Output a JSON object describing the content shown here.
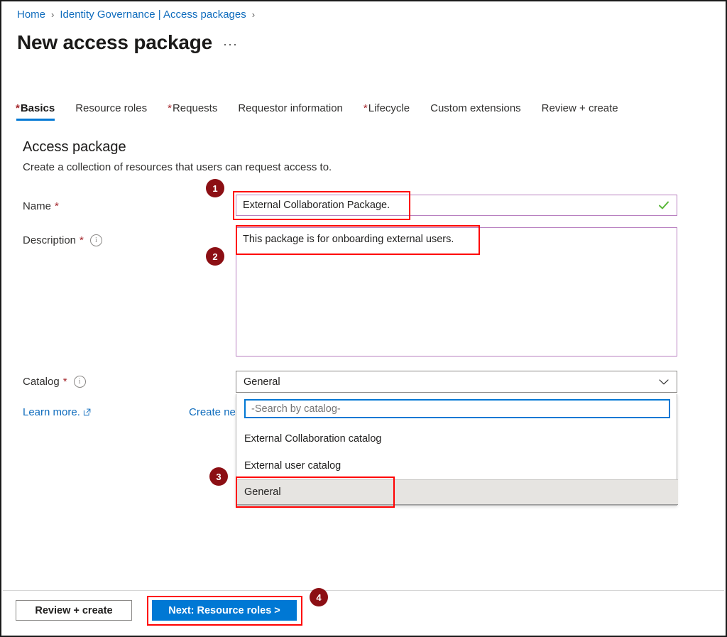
{
  "breadcrumb": {
    "items": [
      {
        "label": "Home"
      },
      {
        "label": "Identity Governance | Access packages"
      }
    ],
    "separator": "›"
  },
  "header": {
    "title": "New access package",
    "ellipsis": "···"
  },
  "tabs": [
    {
      "label": "Basics",
      "required": true,
      "active": true
    },
    {
      "label": "Resource roles",
      "required": false,
      "active": false
    },
    {
      "label": "Requests",
      "required": true,
      "active": false
    },
    {
      "label": "Requestor information",
      "required": false,
      "active": false
    },
    {
      "label": "Lifecycle",
      "required": true,
      "active": false
    },
    {
      "label": "Custom extensions",
      "required": false,
      "active": false
    },
    {
      "label": "Review + create",
      "required": false,
      "active": false
    }
  ],
  "section": {
    "title": "Access package",
    "subtitle": "Create a collection of resources that users can request access to."
  },
  "form": {
    "name": {
      "label": "Name",
      "required_marker": "*",
      "value": "External Collaboration Package.",
      "validation_icon": "checkmark-icon"
    },
    "description": {
      "label": "Description",
      "required_marker": "*",
      "info_icon": "info-icon",
      "value": "This package is for onboarding external users."
    },
    "catalog": {
      "label": "Catalog",
      "required_marker": "*",
      "info_icon": "info-icon",
      "selected": "General",
      "chevron_icon": "chevron-down-icon",
      "dropdown": {
        "search_placeholder": "-Search by catalog-",
        "search_value": "",
        "options": [
          {
            "label": "External Collaboration catalog",
            "selected": false
          },
          {
            "label": "External user catalog",
            "selected": false
          },
          {
            "label": "General",
            "selected": true
          }
        ]
      }
    }
  },
  "links": {
    "learn_more": "Learn more.",
    "learn_more_icon": "external-link-icon",
    "create_new": "Create ne"
  },
  "footer": {
    "review_create": "Review + create",
    "next": "Next: Resource roles >"
  },
  "annotations": {
    "badges": [
      {
        "number": "1"
      },
      {
        "number": "2"
      },
      {
        "number": "3"
      },
      {
        "number": "4"
      }
    ],
    "highlight_color": "#ff0000",
    "badge_color": "#8c0f14"
  }
}
